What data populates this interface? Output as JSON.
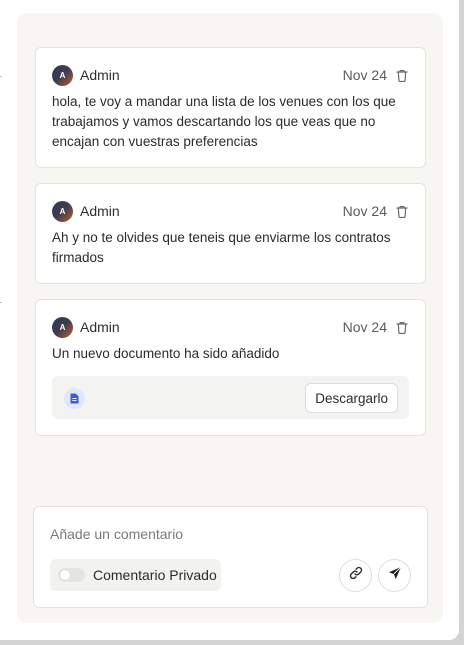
{
  "comments": [
    {
      "author": "Admin",
      "avatar_initial": "A",
      "date": "Nov 24",
      "text": "hola, te voy a mandar una lista de los venues con los que trabajamos y vamos descartando los que veas que no encajan con vuestras preferencias"
    },
    {
      "author": "Admin",
      "avatar_initial": "A",
      "date": "Nov 24",
      "text": "Ah y no te olvides que teneis que enviarme los contratos firmados"
    },
    {
      "author": "Admin",
      "avatar_initial": "A",
      "date": "Nov 24",
      "text": "Un nuevo documento ha sido añadido",
      "attachment": {
        "icon": "document-icon",
        "download_label": "Descargarlo"
      }
    }
  ],
  "composer": {
    "placeholder": "Añade un comentario",
    "private_label": "Comentario Privado",
    "private_enabled": false,
    "attach_icon": "link-icon",
    "send_icon": "send-icon"
  },
  "colors": {
    "panel_bg": "#f7f6f3",
    "card_border": "#e4e3e0",
    "doc_icon_bg": "#dfe7fb",
    "doc_icon_fg": "#3b5bdb"
  }
}
